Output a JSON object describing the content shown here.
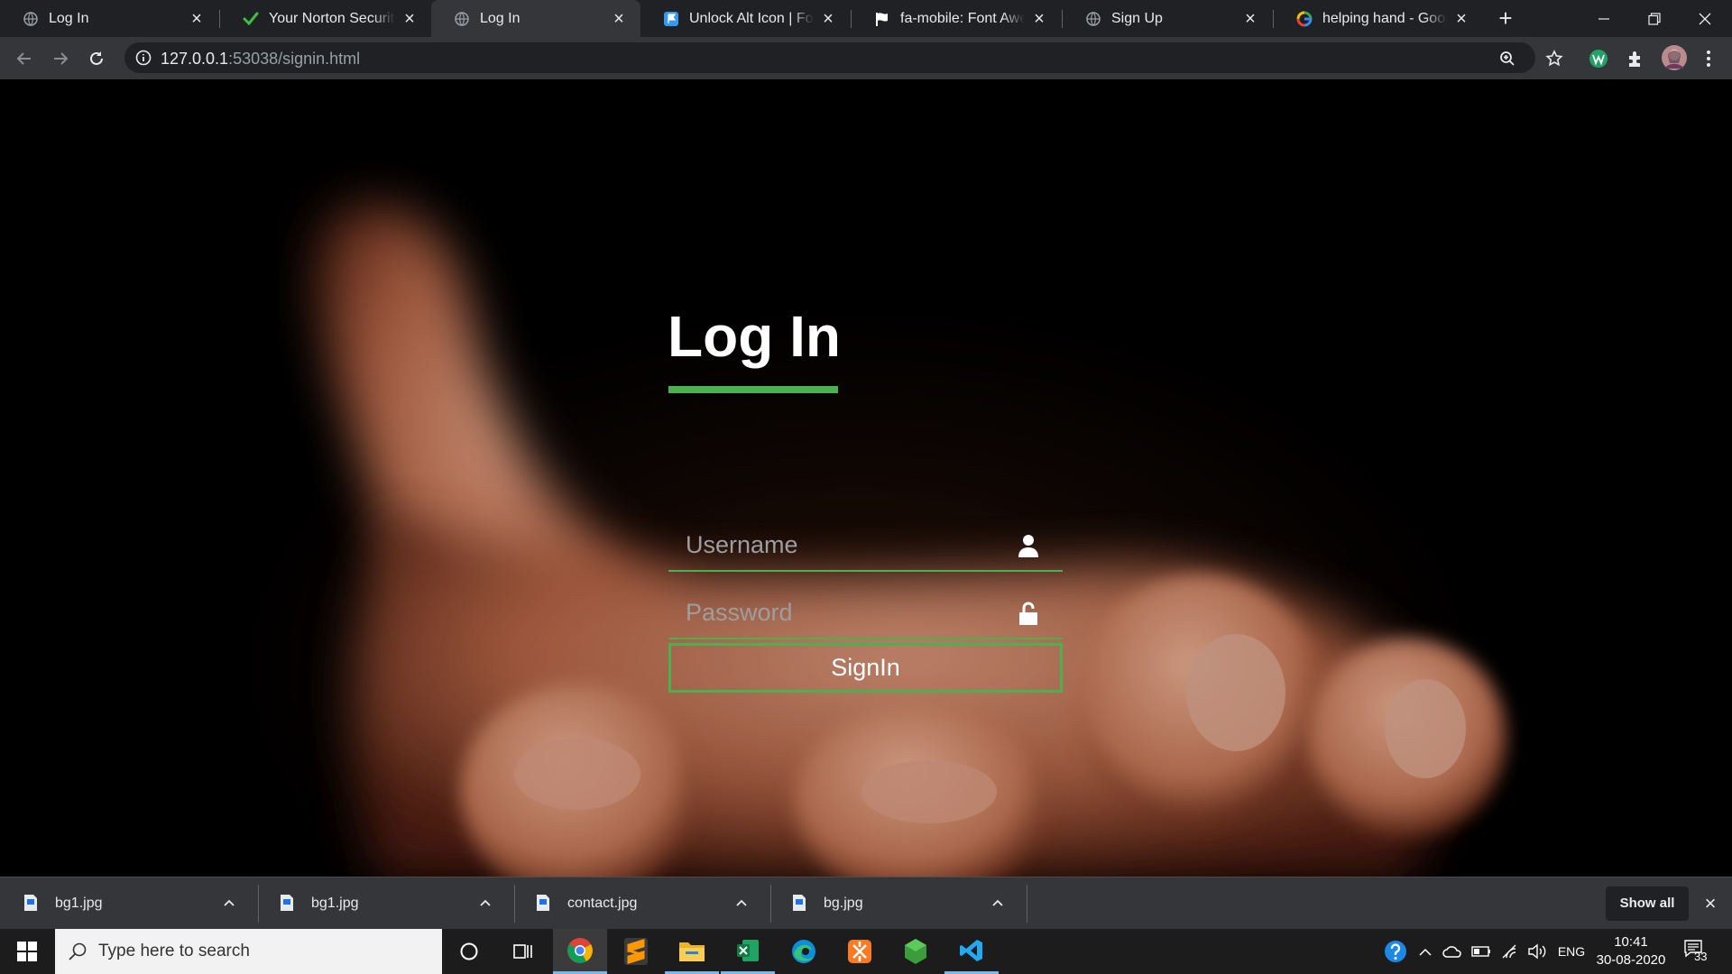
{
  "browser": {
    "tabs": [
      {
        "title": "Log In",
        "icon": "globe-icon",
        "active": false
      },
      {
        "title": "Your Norton Security Li",
        "icon": "checkmark-icon",
        "active": false
      },
      {
        "title": "Log In",
        "icon": "globe-icon",
        "active": true
      },
      {
        "title": "Unlock Alt Icon | Font A",
        "icon": "flag-icon",
        "active": false
      },
      {
        "title": "fa-mobile: Font Aweso",
        "icon": "flag-icon",
        "active": false
      },
      {
        "title": "Sign Up",
        "icon": "globe-icon",
        "active": false
      },
      {
        "title": "helping hand - Google",
        "icon": "google-icon",
        "active": false
      }
    ],
    "url_host": "127.0.0.1",
    "url_rest": ":53038/signin.html"
  },
  "page": {
    "title": "Log In",
    "username_placeholder": "Username",
    "password_placeholder": "Password",
    "signin_label": "SignIn",
    "accent_color": "#4caf50"
  },
  "downloads": {
    "items": [
      "bg1.jpg",
      "bg1.jpg",
      "contact.jpg",
      "bg.jpg"
    ],
    "show_all_label": "Show all"
  },
  "taskbar": {
    "search_placeholder": "Type here to search",
    "language": "ENG",
    "time": "10:41",
    "date": "30-08-2020",
    "notification_count": "33"
  }
}
